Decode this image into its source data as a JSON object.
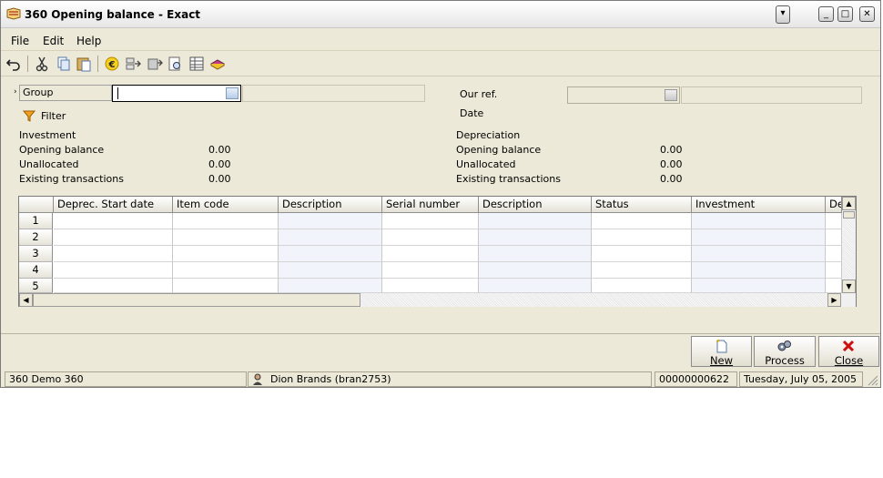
{
  "window": {
    "title": "360 Opening balance - Exact"
  },
  "menu": {
    "file": "File",
    "edit": "Edit",
    "help": "Help"
  },
  "toolbar": {
    "icons": [
      "undo-icon",
      "cut-icon",
      "copy-icon",
      "paste-icon",
      "euro-icon",
      "export-icon",
      "import-icon",
      "preview-icon",
      "columns-icon",
      "book-icon"
    ]
  },
  "form": {
    "group_label": "Group",
    "group_value": "",
    "filter_label": "Filter",
    "our_ref_label": "Our ref.",
    "date_label": "Date"
  },
  "investment": {
    "header": "Investment",
    "rows": [
      {
        "label": "Opening balance",
        "value": "0.00"
      },
      {
        "label": "Unallocated",
        "value": "0.00"
      },
      {
        "label": "Existing transactions",
        "value": "0.00"
      }
    ]
  },
  "depreciation": {
    "header": "Depreciation",
    "rows": [
      {
        "label": "Opening balance",
        "value": "0.00"
      },
      {
        "label": "Unallocated",
        "value": "0.00"
      },
      {
        "label": "Existing transactions",
        "value": "0.00"
      }
    ]
  },
  "grid": {
    "columns": [
      "Deprec. Start date",
      "Item code",
      "Description",
      "Serial number",
      "Description",
      "Status",
      "Investment",
      "De"
    ],
    "row_numbers": [
      "1",
      "2",
      "3",
      "4",
      "5"
    ]
  },
  "buttons": {
    "new": "New",
    "process": "Process",
    "close": "Close"
  },
  "status": {
    "company": "360 Demo 360",
    "user": "Dion Brands (bran2753)",
    "number": "00000000622",
    "date": "Tuesday, July 05, 2005"
  },
  "colors": {
    "window_bg": "#ece9d8",
    "accent": "#7f9db9"
  }
}
